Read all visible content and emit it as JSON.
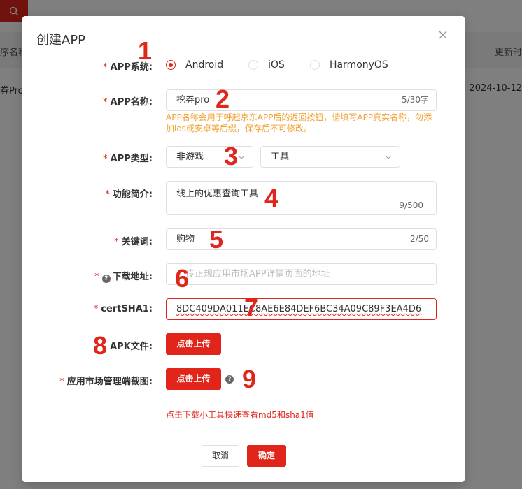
{
  "background": {
    "header_left": "序名称",
    "header_right": "更新时",
    "row_left": "券Pro",
    "row_right": "2024-10-12"
  },
  "modal": {
    "title": "创建APP",
    "fields": {
      "system": {
        "label": "APP系统:",
        "options": [
          "Android",
          "iOS",
          "HarmonyOS"
        ],
        "selected": "Android"
      },
      "name": {
        "label": "APP名称:",
        "value": "挖券pro",
        "count": "5/30字",
        "hint": "APP名称会用于呼起京东APP后的返回按钮，请填写APP真实名称，勿添加ios或安卓等后缀，保存后不可修改。"
      },
      "type": {
        "label": "APP类型:",
        "primary": "非游戏",
        "secondary": "工具"
      },
      "intro": {
        "label": "功能简介:",
        "value": "线上的优惠查询工具",
        "count": "9/500"
      },
      "keywords": {
        "label": "关键词:",
        "value": "购物",
        "count": "2/50"
      },
      "download": {
        "label": "下载地址:",
        "placeholder": "上传正规应用市场APP详情页面的地址"
      },
      "sha1": {
        "label": "certSHA1:",
        "value": "8DC409DA011EC8AE6E84DEF6BC34A09C89F3EA4D6"
      },
      "apk": {
        "label": "APK文件:",
        "button": "点击上传"
      },
      "screenshot": {
        "label": "应用市场管理端截图:",
        "button": "点击上传"
      }
    },
    "tool_link": "点击下载小工具快速查看md5和sha1值",
    "cancel": "取消",
    "confirm": "确定"
  },
  "annotations": [
    "1",
    "2",
    "3",
    "4",
    "5",
    "6",
    "7",
    "8",
    "9"
  ],
  "colors": {
    "accent": "#e1251b",
    "hint": "#f0a030",
    "annotation": "#e1251b"
  }
}
